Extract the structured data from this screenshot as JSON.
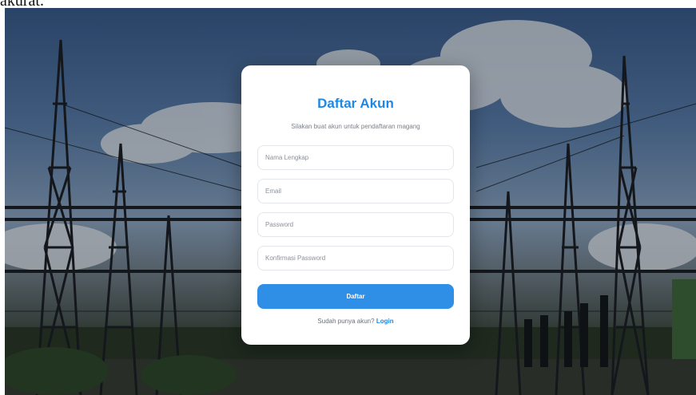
{
  "page_text": "akurat.",
  "background": {
    "image_description": "photo-electrical-substation-transmission-towers"
  },
  "form": {
    "title": "Daftar Akun",
    "subtitle": "Silakan buat akun untuk pendaftaran magang",
    "fields": {
      "name_placeholder": "Nama Lengkap",
      "email_placeholder": "Email",
      "password_placeholder": "Password",
      "confirm_placeholder": "Konfirmasi Password"
    },
    "submit_label": "Daftar",
    "footer_text": "Sudah punya akun?",
    "login_link": "Login"
  },
  "colors": {
    "accent": "#1e88e5",
    "button": "#2f8fe6",
    "card": "#ffffff"
  }
}
